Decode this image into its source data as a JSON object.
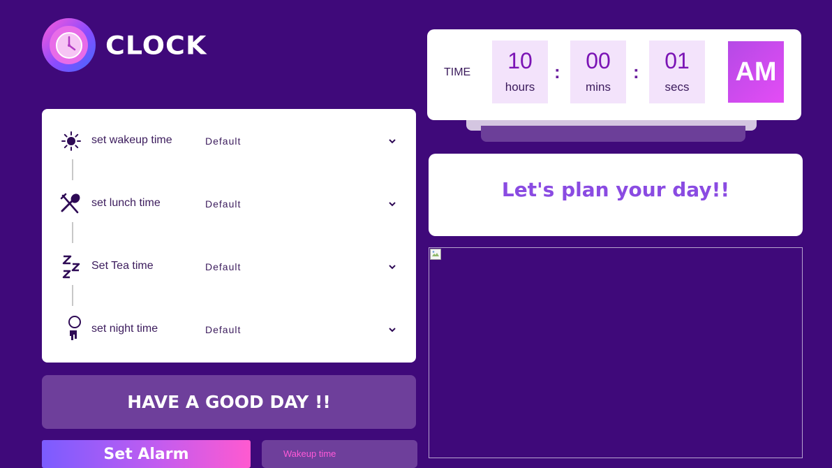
{
  "app": {
    "title": "CLOCK",
    "logo_icon": "clock-icon"
  },
  "time": {
    "label": "TIME",
    "hours": "10",
    "hours_unit": "hours",
    "mins": "00",
    "mins_unit": "mins",
    "secs": "01",
    "secs_unit": "secs",
    "separator": ":",
    "period": "AM"
  },
  "plan": {
    "message": "Let's plan your day!!"
  },
  "settings": {
    "items": [
      {
        "icon": "sun-icon",
        "label": "set wakeup time",
        "value": "Default"
      },
      {
        "icon": "fork-spoon-icon",
        "label": "set lunch time",
        "value": "Default"
      },
      {
        "icon": "zzz-icon",
        "label": "Set Tea time",
        "value": "Default"
      },
      {
        "icon": "moon-icon",
        "label": "set night time",
        "value": "Default"
      }
    ]
  },
  "footer": {
    "greeting": "HAVE A GOOD DAY !!",
    "set_alarm_label": "Set Alarm",
    "wakeup_label": "Wakeup time"
  },
  "colors": {
    "background": "#3f097a",
    "accent": "#8a4be2",
    "time_digits": "#7b14b5",
    "am_box": "#d04cf0"
  }
}
